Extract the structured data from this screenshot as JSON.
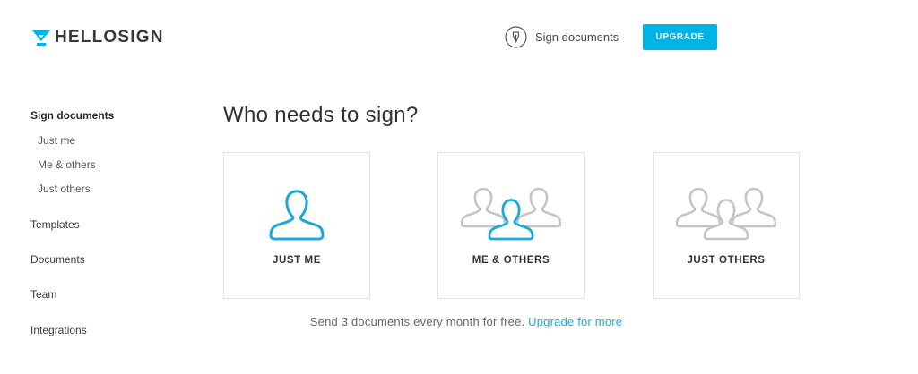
{
  "brand": {
    "name": "HELLOSIGN",
    "accent": "#00b3e6",
    "logo_icon": "hellosign-check-icon"
  },
  "header": {
    "sign_link": {
      "label": "Sign documents",
      "icon": "pen-nib-icon"
    },
    "upgrade_label": "UPGRADE"
  },
  "sidebar": {
    "section_title": "Sign documents",
    "sub_items": [
      "Just me",
      "Me & others",
      "Just others"
    ],
    "items": [
      "Templates",
      "Documents",
      "Team",
      "Integrations"
    ]
  },
  "main": {
    "title": "Who needs to sign?",
    "cards": [
      {
        "label": "JUST ME",
        "icon": "single-user-icon"
      },
      {
        "label": "ME & OTHERS",
        "icon": "user-group-highlighted-icon"
      },
      {
        "label": "JUST OTHERS",
        "icon": "user-group-icon"
      }
    ],
    "footer_text": "Send 3 documents every month for free.",
    "footer_link": "Upgrade for more"
  }
}
